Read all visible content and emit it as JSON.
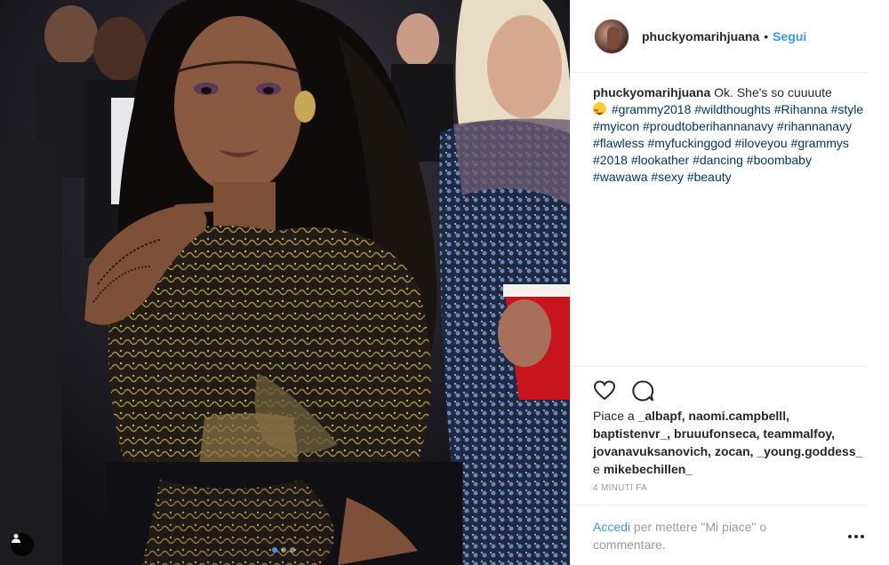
{
  "post": {
    "author": "phuckyomarihjuana",
    "separator": "•",
    "follow_label": "Segui",
    "caption_text": "Ok. She's so cuuuute",
    "caption_emoji": "heart-eyes-emoji",
    "hashtags": "#grammy2018 #wildthoughts #Rihanna #style #myicon #proudtoberihannanavy #rihannanavy #flawless #myfuckinggod #iloveyou #grammys #2018 #lookather #dancing #boombaby #wawawa #sexy #beauty",
    "likes_prefix": "Piace a",
    "likers": "_albapf, naomi.campbelll, baptistenvr_, bruuufonseca, teammalfoy, jovanavuksanovich, zocan, _young.goddess_",
    "likes_conjunction": "e",
    "last_liker": "mikebechillen_",
    "timestamp": "4 MINUTI FA",
    "login_link": "Accedi",
    "login_rest": "per mettere \"Mi piace\" o commentare.",
    "carousel": {
      "count": 3,
      "active": 1
    }
  },
  "colors": {
    "link": "#3897f0",
    "hashtag": "#003569",
    "text": "#262626",
    "muted": "#999999"
  }
}
